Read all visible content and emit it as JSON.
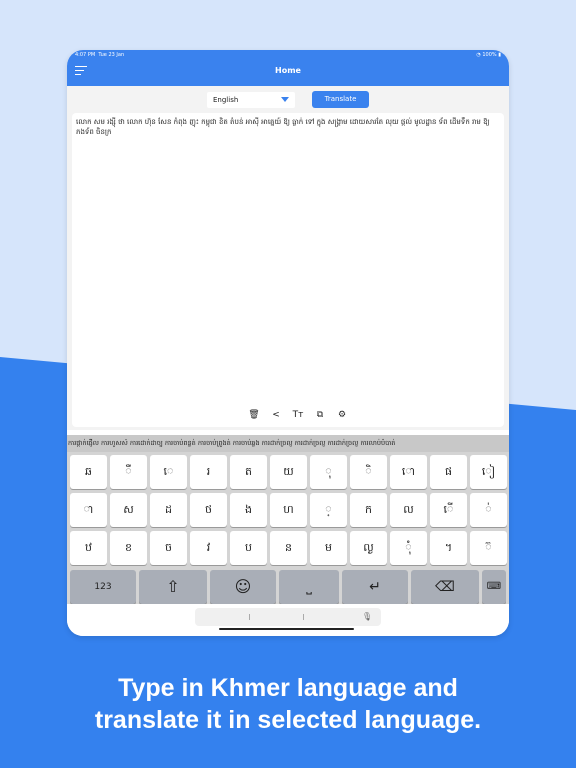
{
  "status_bar": {
    "time": "4:07 PM",
    "date": "Tue 23 Jan",
    "battery": "100%"
  },
  "header": {
    "title": "Home",
    "menu_icon": "hamburger-icon"
  },
  "translate_bar": {
    "language": "English",
    "translate_label": "Translate"
  },
  "input_text": "លោក សម រង្ស៊ី ថា លោក ហ៊ុន សែន កំពុង ញុះ កម្ពុជា ខិត តំបន់ អាស៊ី អាគ្នេយ៍ ឱ្យ ធ្លាក់ ទៅ ក្នុង សង្គ្រាម ដោយសារតែ លុយ ផ្តល់ មូលដ្ឋាន ទ័ព ដើមទឹក រាម ឱ្យ ភងទ័ព ចិន​ក្រ",
  "tools": [
    "delete-icon",
    "share-icon",
    "text-size-icon",
    "copy-icon",
    "settings-icon"
  ],
  "suggestions": "ការផ្ដាក់ផ្ញើល ការហូសស៉ ការដោក់ដាច្ប ការចាប់ពន្លត់ ការចាប់ព្រូងត់ ការចាប់ឆ្លង ការដាក់ច្រល្ញ ការដាក់ច្រល្ញ ការដាក់ច្រល្ញ ការលាប់បំបាត់",
  "keyboard": {
    "row1": [
      "ឆ",
      "ឺ",
      "េ",
      "រ",
      "ត",
      "យ",
      "ុ",
      "ិ",
      "ោ",
      "ផ",
      "ៀ"
    ],
    "row2": [
      "ា",
      "ស",
      "ដ",
      "ថ",
      "ង",
      "ហ",
      "្",
      "ក",
      "ល",
      "ើ",
      "់"
    ],
    "row3": [
      "ឋ",
      "ខ",
      "ច",
      "វ",
      "ប",
      "ន",
      "ម",
      "ល្ង",
      "ំុ",
      "។",
      "៊"
    ],
    "numbers_label": "123"
  },
  "tagline": {
    "line1": "Type in Khmer language and",
    "line2": "translate it in selected language."
  }
}
